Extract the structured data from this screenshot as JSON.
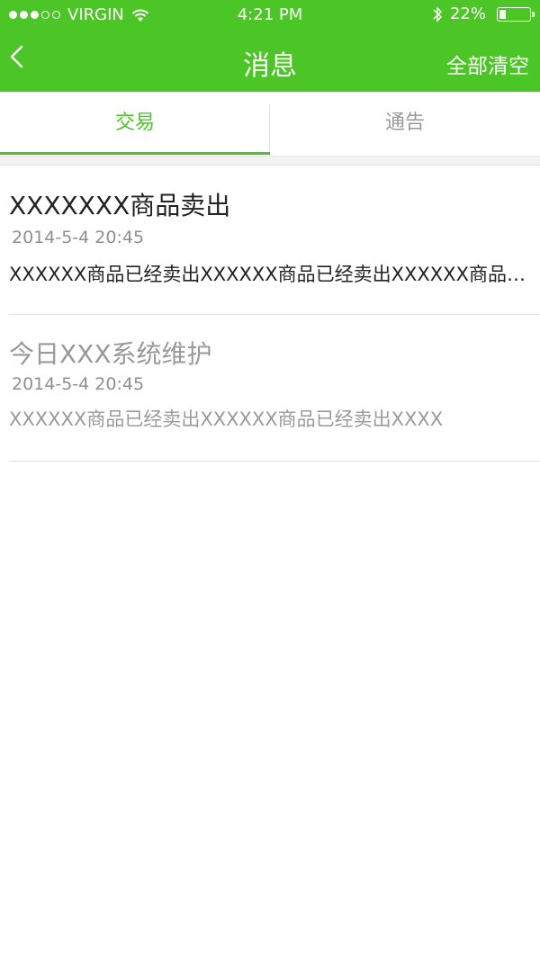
{
  "status_bar": {
    "carrier": "VIRGIN",
    "time": "4:21 PM",
    "battery_percent": "22%",
    "battery_level": 0.22,
    "signal_bars_filled": 3,
    "signal_bars_total": 5
  },
  "nav": {
    "title": "消息",
    "back_icon": "chevron-left-icon",
    "clear_all_label": "全部清空"
  },
  "tabs": [
    {
      "label": "交易",
      "active": true
    },
    {
      "label": "通告",
      "active": false
    }
  ],
  "messages": [
    {
      "title": "XXXXXXX商品卖出",
      "date": "2014-5-4 20:45",
      "body": "XXXXXX商品已经卖出XXXXXX商品已经卖出XXXXXX商品已经卖出",
      "read": false
    },
    {
      "title": "今日XXX系统维护",
      "date": "2014-5-4 20:45",
      "body": "XXXXXX商品已经卖出XXXXXX商品已经卖出XXXX",
      "read": true
    }
  ],
  "colors": {
    "accent": "#4cc526",
    "text_primary": "#222222",
    "text_muted": "#999999"
  }
}
